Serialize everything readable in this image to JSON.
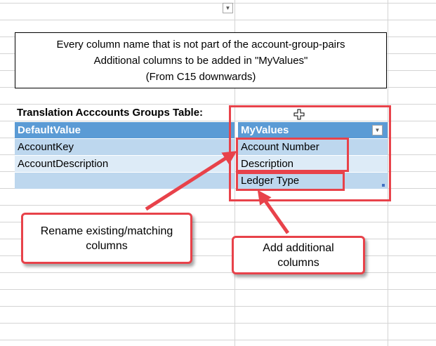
{
  "note": {
    "line1": "Every column name that is not part of the account-group-pairs",
    "line2": "Additional columns to be added in \"MyValues\"",
    "line3": "(From C15 downwards)"
  },
  "table": {
    "title": "Translation Acccounts Groups Table:",
    "headers": [
      "DefaultValue",
      "MyValues"
    ],
    "rows": [
      [
        "AccountKey",
        "Account Number"
      ],
      [
        "AccountDescription",
        "Description"
      ],
      [
        "",
        "Ledger Type"
      ]
    ]
  },
  "callouts": {
    "rename": "Rename existing/matching columns",
    "add": "Add additional columns"
  },
  "icons": {
    "dropdown": "chevron-down-icon",
    "cursor": "move-cursor-icon"
  },
  "colors": {
    "header": "#5b9bd5",
    "row_band_dark": "#bdd7ee",
    "row_band_light": "#ddebf7",
    "annotation_red": "#e8424a"
  }
}
